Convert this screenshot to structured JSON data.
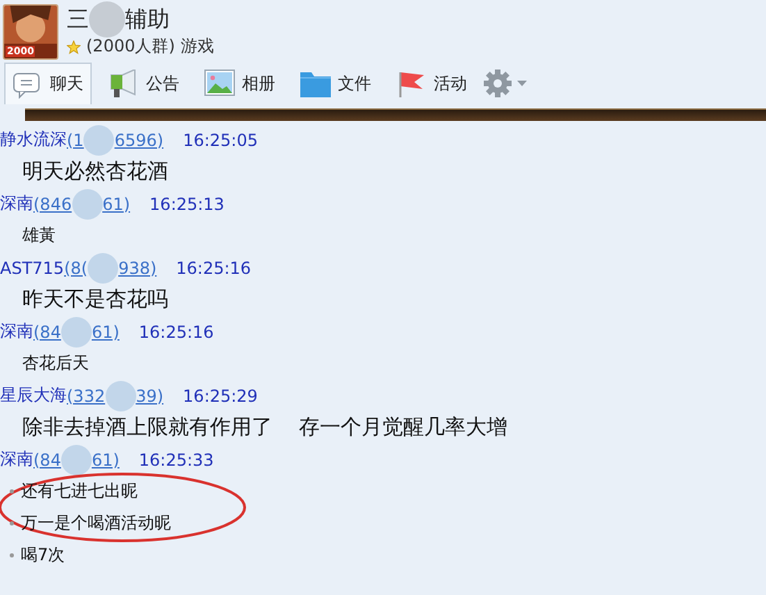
{
  "header": {
    "title_start": "三",
    "title_end": "辅助",
    "member_count": "(2000人群)",
    "category": "游戏",
    "avatar_badge": "2000"
  },
  "tabs": [
    {
      "label": "聊天",
      "selected": true
    },
    {
      "label": "公告",
      "selected": false
    },
    {
      "label": "相册",
      "selected": false
    },
    {
      "label": "文件",
      "selected": false
    },
    {
      "label": "活动",
      "selected": false
    }
  ],
  "messages": [
    {
      "sender": "静水流深",
      "id_start": "(1",
      "id_end": "6596)",
      "time": "16:25:05",
      "lines": [
        {
          "text": "明天必然杏花酒",
          "kind": "large"
        }
      ]
    },
    {
      "sender": "深南",
      "id_start": "(846",
      "id_end": "61)",
      "time": "16:25:13",
      "lines": [
        {
          "text": "雄黃",
          "kind": "small"
        }
      ]
    },
    {
      "sender": "AST715",
      "id_start": "(8(",
      "id_end": "938)",
      "time": "16:25:16",
      "lines": [
        {
          "text": "昨天不是杏花吗",
          "kind": "large"
        }
      ]
    },
    {
      "sender": "深南",
      "id_start": "(84",
      "id_end": "61)",
      "time": "16:25:16",
      "lines": [
        {
          "text": "杏花后天",
          "kind": "small"
        }
      ]
    },
    {
      "sender": "星辰大海",
      "id_start": "(332",
      "id_end": "39)",
      "time": "16:25:29",
      "lines": [
        {
          "text": "除非去掉酒上限就有作用了    存一个月觉醒几率大增",
          "kind": "large"
        }
      ]
    },
    {
      "sender": "深南",
      "id_start": "(84",
      "id_end": "61)",
      "time": "16:25:33",
      "lines": [
        {
          "text": "还有七进七出昵",
          "kind": "bullet"
        },
        {
          "text": "万一是个喝酒活动昵",
          "kind": "bullet"
        },
        {
          "text": "喝7次",
          "kind": "bullet"
        }
      ]
    }
  ]
}
